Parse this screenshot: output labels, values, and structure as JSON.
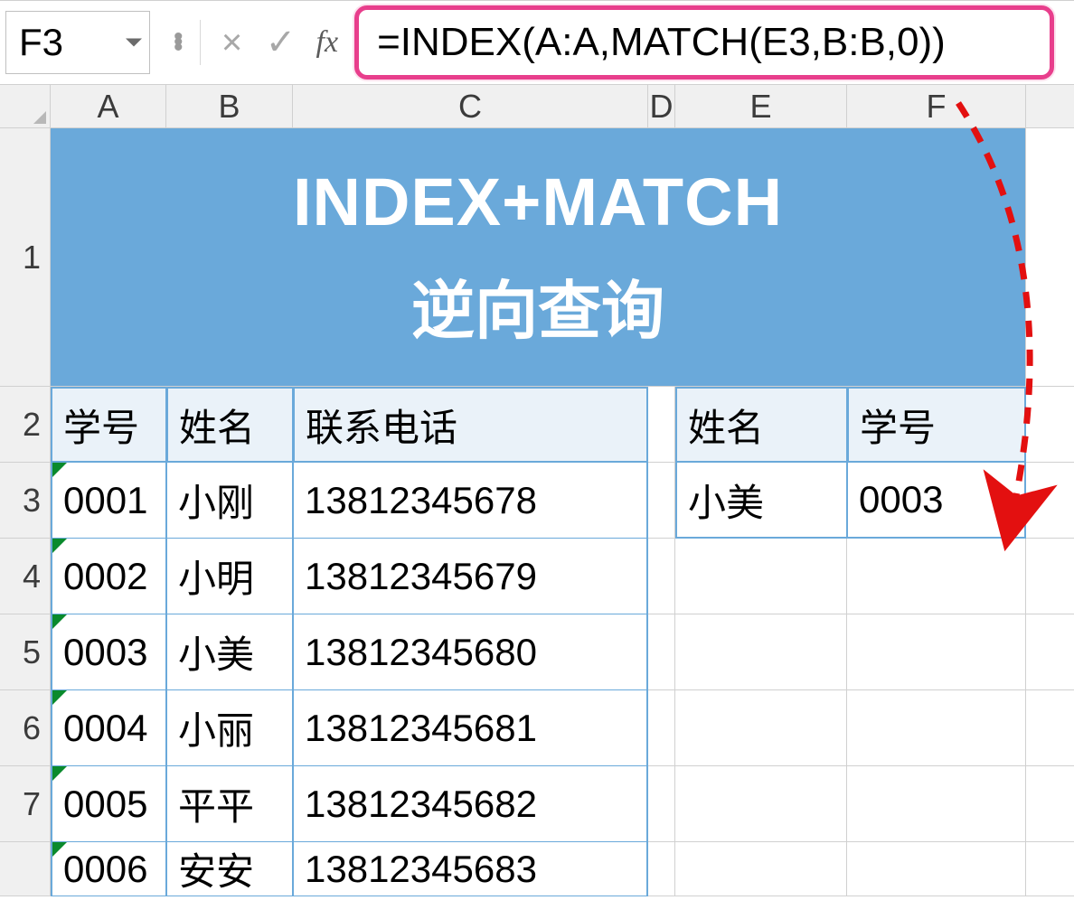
{
  "name_box": "F3",
  "formula": "=INDEX(A:A,MATCH(E3,B:B,0))",
  "columns": [
    "A",
    "B",
    "C",
    "D",
    "E",
    "F"
  ],
  "rows": [
    "1",
    "2",
    "3",
    "4",
    "5",
    "6",
    "7"
  ],
  "title": {
    "line1": "INDEX+MATCH",
    "line2": "逆向查询"
  },
  "table": {
    "headers": [
      "学号",
      "姓名",
      "联系电话"
    ],
    "data": [
      [
        "0001",
        "小刚",
        "13812345678"
      ],
      [
        "0002",
        "小明",
        "13812345679"
      ],
      [
        "0003",
        "小美",
        "13812345680"
      ],
      [
        "0004",
        "小丽",
        "13812345681"
      ],
      [
        "0005",
        "平平",
        "13812345682"
      ],
      [
        "0006",
        "安安",
        "13812345683"
      ]
    ]
  },
  "lookup": {
    "headers": [
      "姓名",
      "学号"
    ],
    "data": [
      "小美",
      "0003"
    ]
  },
  "fx_label": "fx",
  "cancel_icon": "×",
  "accept_icon": "✓"
}
